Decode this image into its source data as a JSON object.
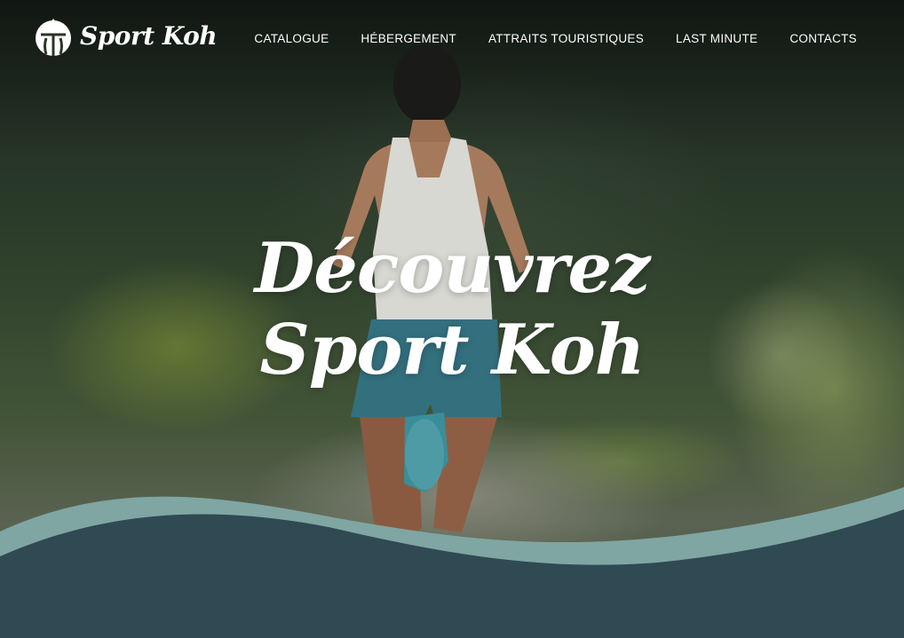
{
  "brand": {
    "name": "Sport Koh",
    "logo_icon": "mountain-icon"
  },
  "nav": {
    "items": [
      {
        "label": "CATALOGUE"
      },
      {
        "label": "HÉBERGEMENT"
      },
      {
        "label": "ATTRAITS TOURISTIQUES"
      },
      {
        "label": "LAST MINUTE"
      },
      {
        "label": "CONTACTS"
      }
    ]
  },
  "hero": {
    "title_line1": "Découvrez",
    "title_line2": "Sport Koh"
  },
  "colors": {
    "wave_light": "#7fa6a3",
    "wave_dark": "#2f4a52",
    "text": "#ffffff"
  }
}
